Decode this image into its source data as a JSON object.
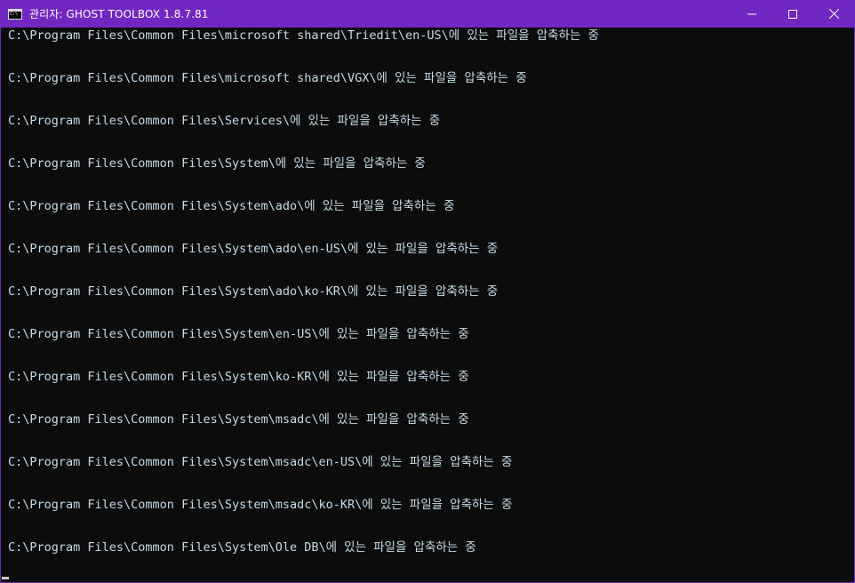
{
  "window": {
    "title": "관리자:  GHOST TOOLBOX 1.8.7.81",
    "icon": "console-icon",
    "colors": {
      "titlebar": "#7327c2",
      "console_bg": "#0c0c0c",
      "console_text": "#c4dbe8"
    }
  },
  "controls": {
    "minimize": "minimize-icon",
    "maximize": "maximize-icon",
    "close": "close-icon"
  },
  "console": {
    "lines": [
      "C:\\Program Files\\Common Files\\microsoft shared\\Triedit\\en-US\\에 있는 파일을 압축하는 중",
      "C:\\Program Files\\Common Files\\microsoft shared\\VGX\\에 있는 파일을 압축하는 중",
      "C:\\Program Files\\Common Files\\Services\\에 있는 파일을 압축하는 중",
      "C:\\Program Files\\Common Files\\System\\에 있는 파일을 압축하는 중",
      "C:\\Program Files\\Common Files\\System\\ado\\에 있는 파일을 압축하는 중",
      "C:\\Program Files\\Common Files\\System\\ado\\en-US\\에 있는 파일을 압축하는 중",
      "C:\\Program Files\\Common Files\\System\\ado\\ko-KR\\에 있는 파일을 압축하는 중",
      "C:\\Program Files\\Common Files\\System\\en-US\\에 있는 파일을 압축하는 중",
      "C:\\Program Files\\Common Files\\System\\ko-KR\\에 있는 파일을 압축하는 중",
      "C:\\Program Files\\Common Files\\System\\msadc\\에 있는 파일을 압축하는 중",
      "C:\\Program Files\\Common Files\\System\\msadc\\en-US\\에 있는 파일을 압축하는 중",
      "C:\\Program Files\\Common Files\\System\\msadc\\ko-KR\\에 있는 파일을 압축하는 중",
      "C:\\Program Files\\Common Files\\System\\Ole DB\\에 있는 파일을 압축하는 중"
    ]
  }
}
